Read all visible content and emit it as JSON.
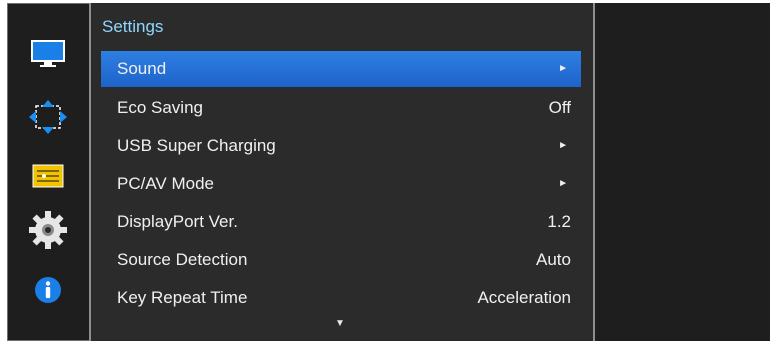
{
  "menu": {
    "title": "Settings",
    "items": [
      {
        "label": "Sound",
        "value": "",
        "arrow": "►"
      },
      {
        "label": "Eco Saving",
        "value": "Off",
        "arrow": ""
      },
      {
        "label": "USB Super Charging",
        "value": "",
        "arrow": "►"
      },
      {
        "label": "PC/AV Mode",
        "value": "",
        "arrow": "►"
      },
      {
        "label": "DisplayPort Ver.",
        "value": "1.2",
        "arrow": ""
      },
      {
        "label": "Source Detection",
        "value": "Auto",
        "arrow": ""
      },
      {
        "label": "Key Repeat Time",
        "value": "Acceleration",
        "arrow": ""
      }
    ],
    "scroll_indicator": "▼"
  },
  "rail": {
    "icons": [
      "picture-icon",
      "screen-size-icon",
      "picture-adjust-icon",
      "settings-gear-icon",
      "information-icon"
    ]
  },
  "colors": {
    "selection": "#2f7fe3",
    "title": "#8fd7ff",
    "background": "#1e1e1e"
  }
}
